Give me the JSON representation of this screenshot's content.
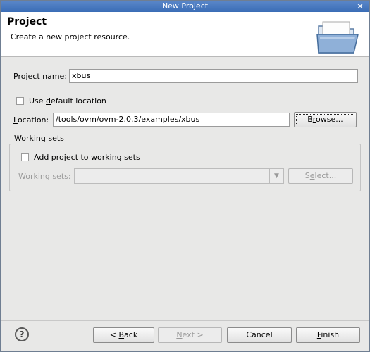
{
  "window": {
    "title": "New Project",
    "close_glyph": "✕"
  },
  "header": {
    "title": "Project",
    "description": "Create a new project resource."
  },
  "form": {
    "project_name_label": "Project name:",
    "project_name_value": "xbus",
    "use_default_pre": "Use ",
    "use_default_mn": "d",
    "use_default_post": "efault location",
    "use_default_checked": false,
    "location_mn": "L",
    "location_post": "ocation:",
    "location_value": "/tools/ovm/ovm-2.0.3/examples/xbus",
    "browse_pre": "B",
    "browse_mn": "r",
    "browse_post": "owse..."
  },
  "working_sets": {
    "group_label": "Working sets",
    "add_pre": "Add proje",
    "add_mn": "c",
    "add_post": "t to working sets",
    "add_checked": false,
    "combo_label_pre": "W",
    "combo_label_mn": "o",
    "combo_label_post": "rking sets:",
    "combo_value": "",
    "select_pre": "S",
    "select_mn": "e",
    "select_post": "lect..."
  },
  "footer": {
    "help_glyph": "?",
    "back_pre": "< ",
    "back_mn": "B",
    "back_post": "ack",
    "next_mn": "N",
    "next_post": "ext >",
    "cancel": "Cancel",
    "finish_mn": "F",
    "finish_post": "inish"
  },
  "colors": {
    "titlebar": "#3a6db6",
    "dialog_bg": "#e8e8e7"
  }
}
